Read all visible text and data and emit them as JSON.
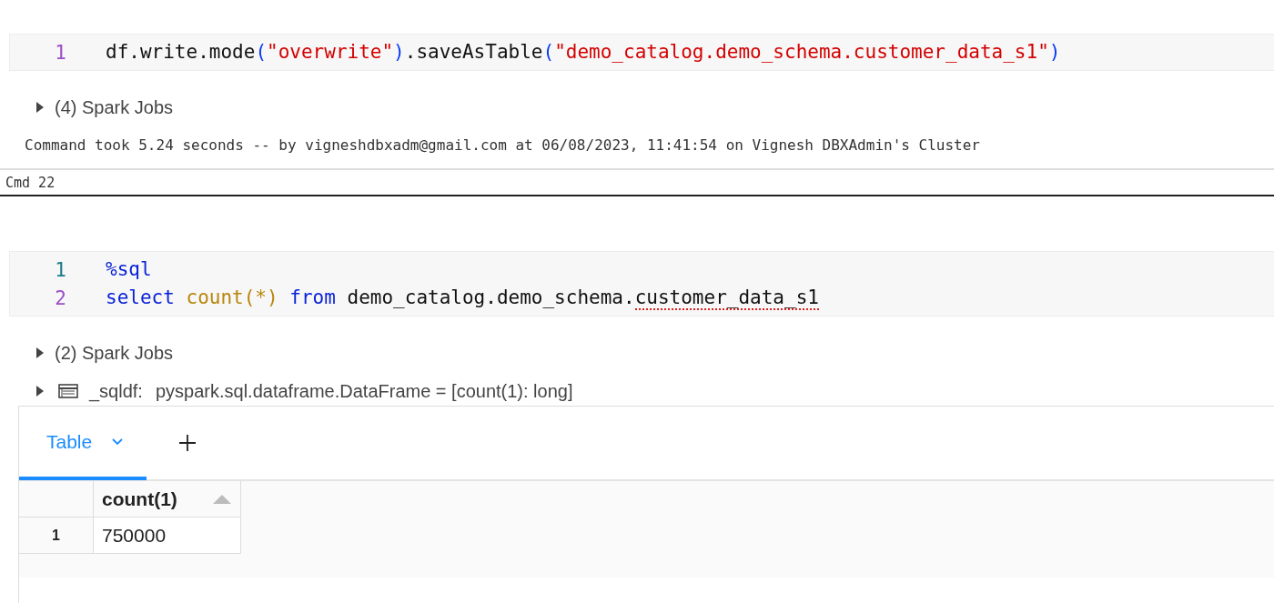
{
  "cells": [
    {
      "code_lines": [
        {
          "number": "1",
          "active": true,
          "tokens": [
            {
              "kind": "plain",
              "text": "df.write.mode"
            },
            {
              "kind": "punct",
              "text": "("
            },
            {
              "kind": "string",
              "text": "\"overwrite\""
            },
            {
              "kind": "punct",
              "text": ")"
            },
            {
              "kind": "plain",
              "text": ".saveAsTable"
            },
            {
              "kind": "punct",
              "text": "("
            },
            {
              "kind": "string",
              "text": "\"demo_catalog.demo_schema.customer_data_s1\""
            },
            {
              "kind": "punct",
              "text": ")"
            }
          ]
        }
      ],
      "outputs": [
        {
          "kind": "jobs",
          "expanded": false,
          "label": "(4) Spark Jobs"
        }
      ],
      "footer": "Command took 5.24 seconds -- by vigneshdbxadm@gmail.com at 06/08/2023, 11:41:54 on Vignesh DBXAdmin's Cluster"
    },
    {
      "header": "Cmd 22",
      "code_lines": [
        {
          "number": "1",
          "active": false,
          "tokens": [
            {
              "kind": "magic",
              "text": "%sql",
              "misspelled": false
            }
          ]
        },
        {
          "number": "2",
          "active": true,
          "tokens": [
            {
              "kind": "keyword",
              "text": "select ",
              "misspelled": false
            },
            {
              "kind": "function",
              "text": "count(*) ",
              "misspelled": false
            },
            {
              "kind": "keyword",
              "text": "from",
              "misspelled": false
            },
            {
              "kind": "plain",
              "text": " demo_catalog.demo_schema.",
              "misspelled": false
            },
            {
              "kind": "plain",
              "text": "customer_data_s1",
              "misspelled": true
            }
          ]
        }
      ],
      "outputs": [
        {
          "kind": "jobs",
          "expanded": false,
          "label": "(2) Spark Jobs"
        },
        {
          "kind": "dataframe",
          "expanded": false,
          "name": "_sqldf:",
          "label": "pyspark.sql.dataframe.DataFrame = [count(1): long]"
        }
      ],
      "result": {
        "tabs": [
          {
            "label": "Table",
            "selected": true
          }
        ],
        "table": {
          "columns": [
            "count(1)"
          ],
          "rows": [
            {
              "index": "1",
              "cells": [
                "750000"
              ]
            }
          ]
        }
      }
    }
  ]
}
